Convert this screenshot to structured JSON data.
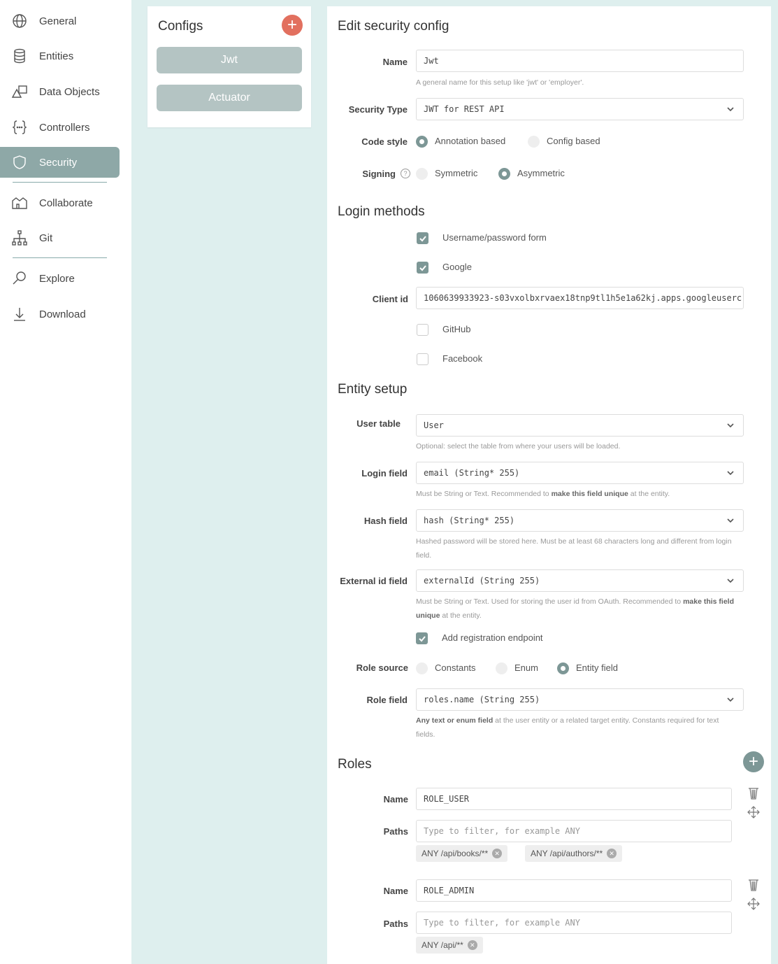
{
  "sidebar": {
    "items": [
      {
        "label": "General",
        "icon": "globe-icon"
      },
      {
        "label": "Entities",
        "icon": "database-icon"
      },
      {
        "label": "Data Objects",
        "icon": "shapes-icon"
      },
      {
        "label": "Controllers",
        "icon": "braces-icon"
      },
      {
        "label": "Security",
        "icon": "shield-icon",
        "active": true
      },
      {
        "label": "Collaborate",
        "icon": "collaborate-icon"
      },
      {
        "label": "Git",
        "icon": "git-tree-icon"
      },
      {
        "label": "Explore",
        "icon": "magnifier-icon"
      },
      {
        "label": "Download",
        "icon": "download-icon"
      }
    ]
  },
  "configs": {
    "title": "Configs",
    "add_label": "+",
    "items": [
      "Jwt",
      "Actuator"
    ]
  },
  "edit": {
    "title": "Edit security config",
    "name": {
      "label": "Name",
      "value": "Jwt",
      "help": "A general name for this setup like 'jwt' or 'employer'."
    },
    "security_type": {
      "label": "Security Type",
      "value": "JWT for REST API"
    },
    "code_style": {
      "label": "Code style",
      "options": [
        "Annotation based",
        "Config based"
      ],
      "selected": "Annotation based"
    },
    "signing": {
      "label": "Signing",
      "help_glyph": "?",
      "options": [
        "Symmetric",
        "Asymmetric"
      ],
      "selected": "Asymmetric"
    }
  },
  "login_methods": {
    "title": "Login methods",
    "username_password": {
      "label": "Username/password form",
      "checked": true
    },
    "google": {
      "label": "Google",
      "checked": true
    },
    "client_id": {
      "label": "Client id",
      "value": "1060639933923-s03vxolbxrvaex18tnp9tl1h5e1a62kj.apps.googleuserc"
    },
    "github": {
      "label": "GitHub",
      "checked": false
    },
    "facebook": {
      "label": "Facebook",
      "checked": false
    }
  },
  "entity_setup": {
    "title": "Entity setup",
    "user_table": {
      "label": "User table",
      "value": "User",
      "help": "Optional: select the table from where your users will be loaded."
    },
    "login_field": {
      "label": "Login field",
      "value": "email (String* 255)",
      "help_pre": "Must be String or Text. Recommended to ",
      "help_bold": "make this field unique",
      "help_post": " at the entity."
    },
    "hash_field": {
      "label": "Hash field",
      "value": "hash (String* 255)",
      "help": "Hashed password will be stored here. Must be at least 68 characters long and different from login field."
    },
    "external_id_field": {
      "label": "External id field",
      "value": "externalId (String 255)",
      "help_pre": "Must be String or Text. Used for storing the user id from OAuth. Recommended to ",
      "help_bold": "make this field unique",
      "help_post": " at the entity."
    },
    "add_registration": {
      "label": "Add registration endpoint",
      "checked": true
    },
    "role_source": {
      "label": "Role source",
      "options": [
        "Constants",
        "Enum",
        "Entity field"
      ],
      "selected": "Entity field"
    },
    "role_field": {
      "label": "Role field",
      "value": "roles.name (String 255)",
      "help_bold": "Any text or enum field",
      "help_post": " at the user entity or a related target entity. Constants required for text fields."
    }
  },
  "roles": {
    "title": "Roles",
    "add_label": "+",
    "name_label": "Name",
    "paths_label": "Paths",
    "paths_placeholder": "Type to filter, for example ANY",
    "items": [
      {
        "name": "ROLE_USER",
        "paths": [
          "ANY /api/books/**",
          "ANY /api/authors/**"
        ]
      },
      {
        "name": "ROLE_ADMIN",
        "paths": [
          "ANY /api/**"
        ]
      }
    ]
  },
  "colors": {
    "accent": "#7d9796",
    "active_nav": "#8ea8a7",
    "add_red": "#e2705f",
    "config_button": "#b4c4c3",
    "background": "#deefee"
  }
}
